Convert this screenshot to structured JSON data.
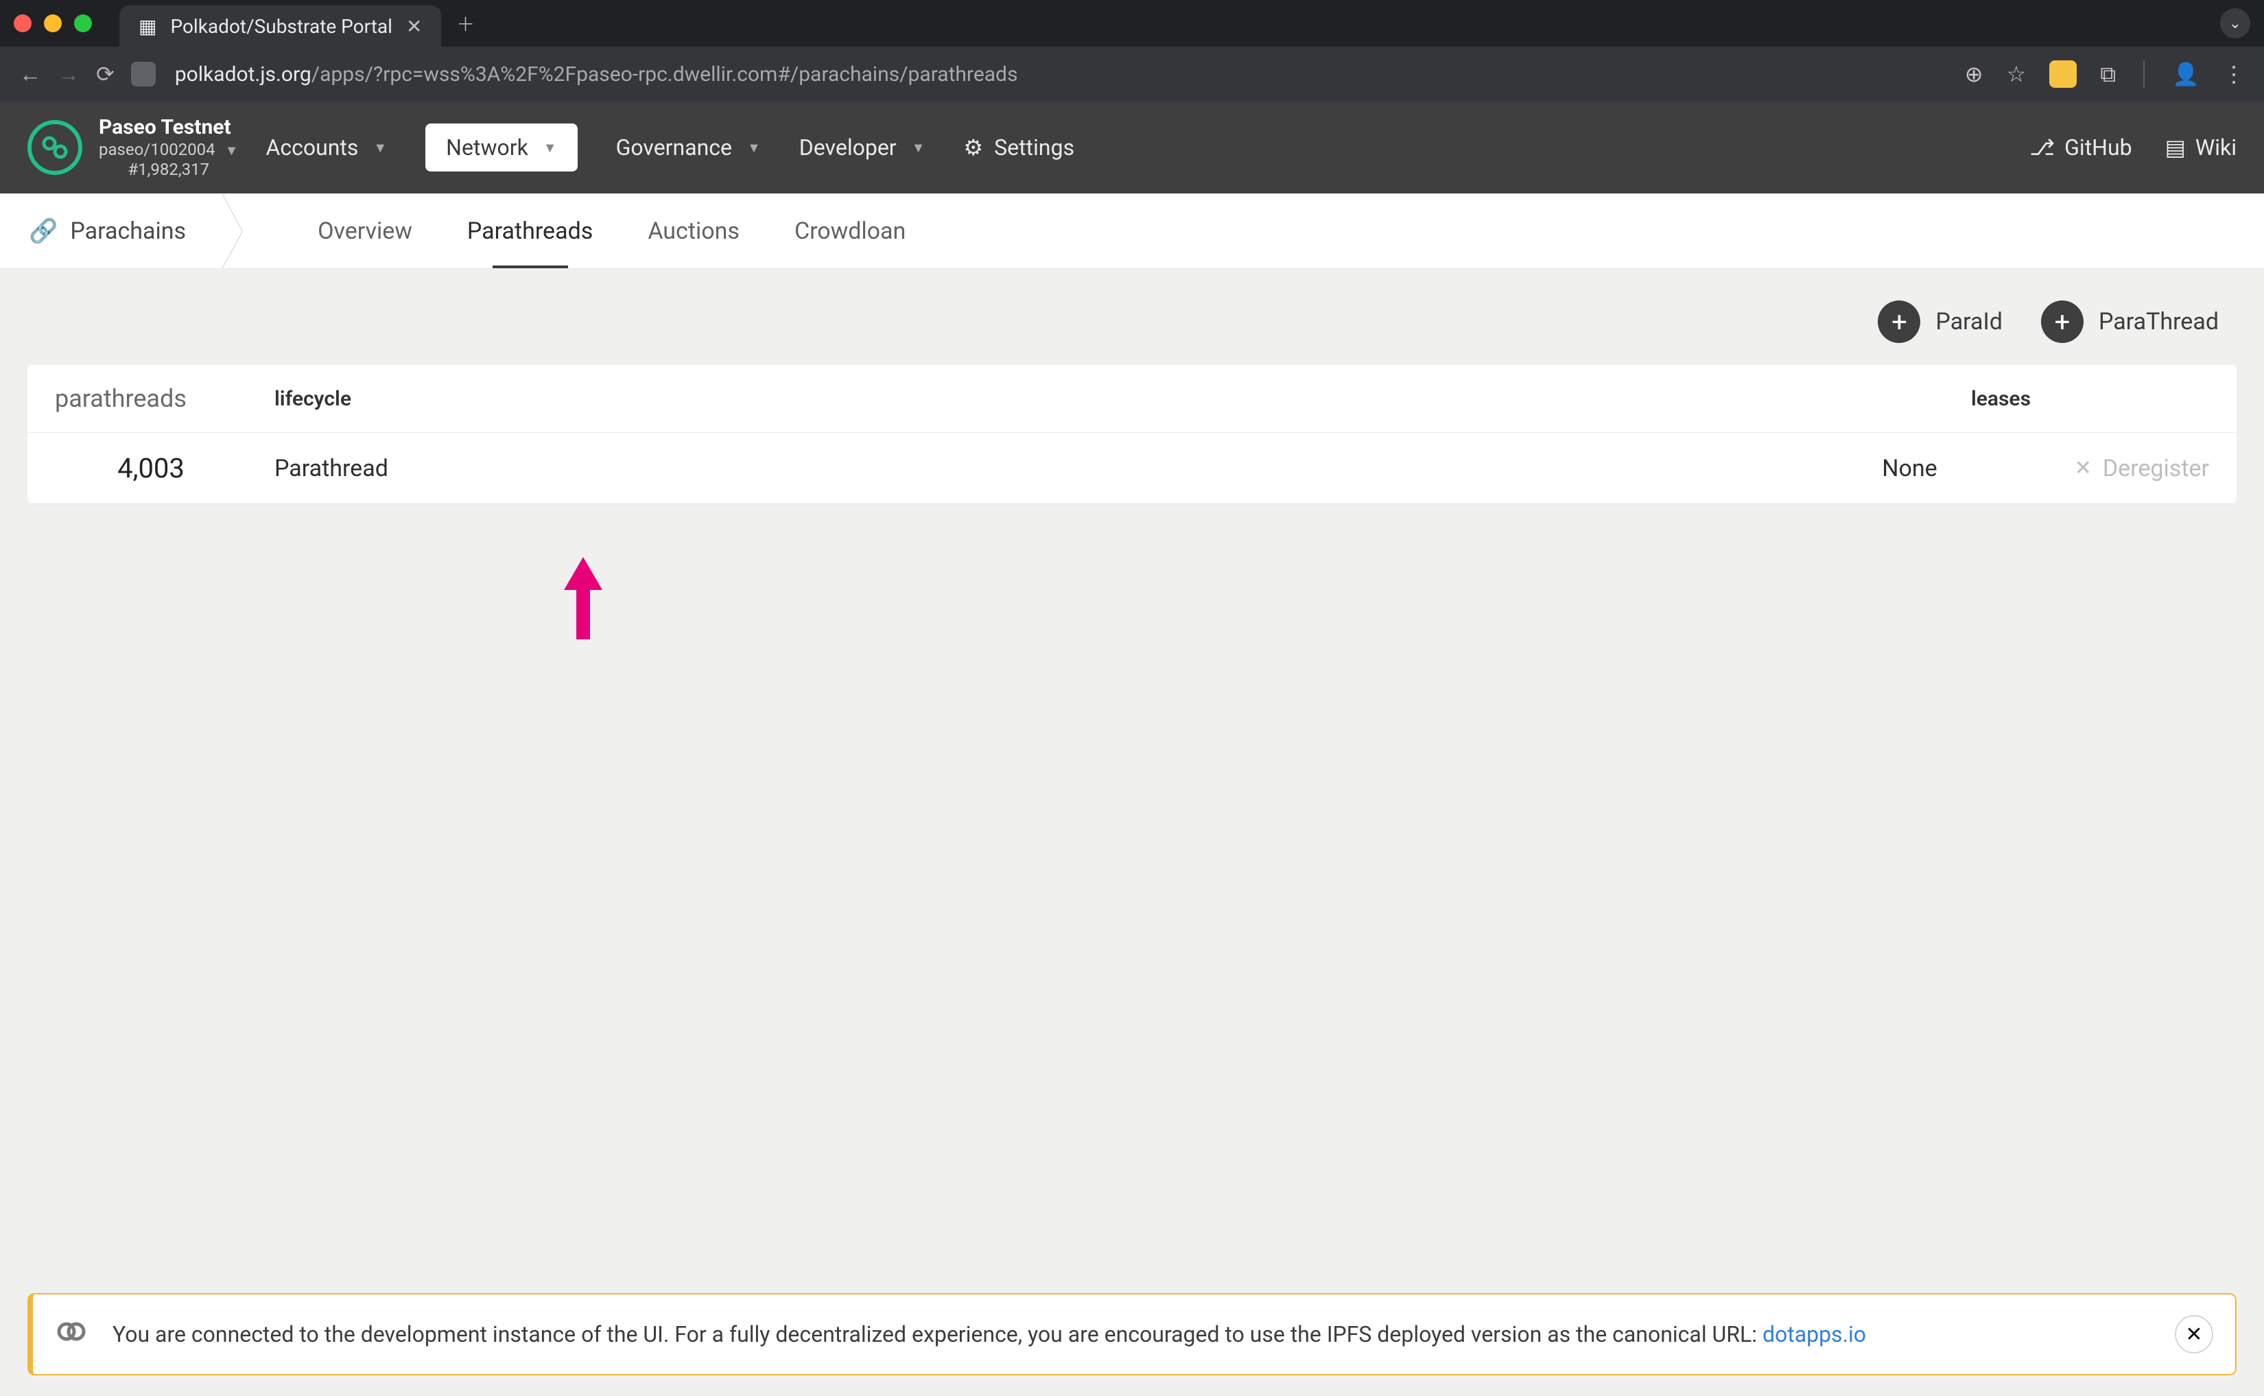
{
  "browser": {
    "tab_title": "Polkadot/Substrate Portal",
    "url_host": "polkadot.js.org",
    "url_path": "/apps/?rpc=wss%3A%2F%2Fpaseo-rpc.dwellir.com#/parachains/parathreads"
  },
  "chain": {
    "name": "Paseo Testnet",
    "spec": "paseo/1002004",
    "block": "#1,982,317"
  },
  "topmenu": {
    "accounts": "Accounts",
    "network": "Network",
    "governance": "Governance",
    "developer": "Developer",
    "settings": "Settings"
  },
  "rightlinks": {
    "github": "GitHub",
    "wiki": "Wiki"
  },
  "breadcrumb": {
    "label": "Parachains"
  },
  "subtabs": {
    "overview": "Overview",
    "parathreads": "Parathreads",
    "auctions": "Auctions",
    "crowdloan": "Crowdloan"
  },
  "actions": {
    "paraid": "ParaId",
    "parathread": "ParaThread"
  },
  "table": {
    "title": "parathreads",
    "columns": {
      "lifecycle": "lifecycle",
      "leases": "leases"
    },
    "rows": [
      {
        "id": "4,003",
        "lifecycle": "Parathread",
        "leases": "None",
        "action": "Deregister"
      }
    ]
  },
  "banner": {
    "text": "You are connected to the development instance of the UI. For a fully decentralized experience, you are encouraged to use the IPFS deployed version as the canonical URL: ",
    "link": "dotapps.io"
  }
}
